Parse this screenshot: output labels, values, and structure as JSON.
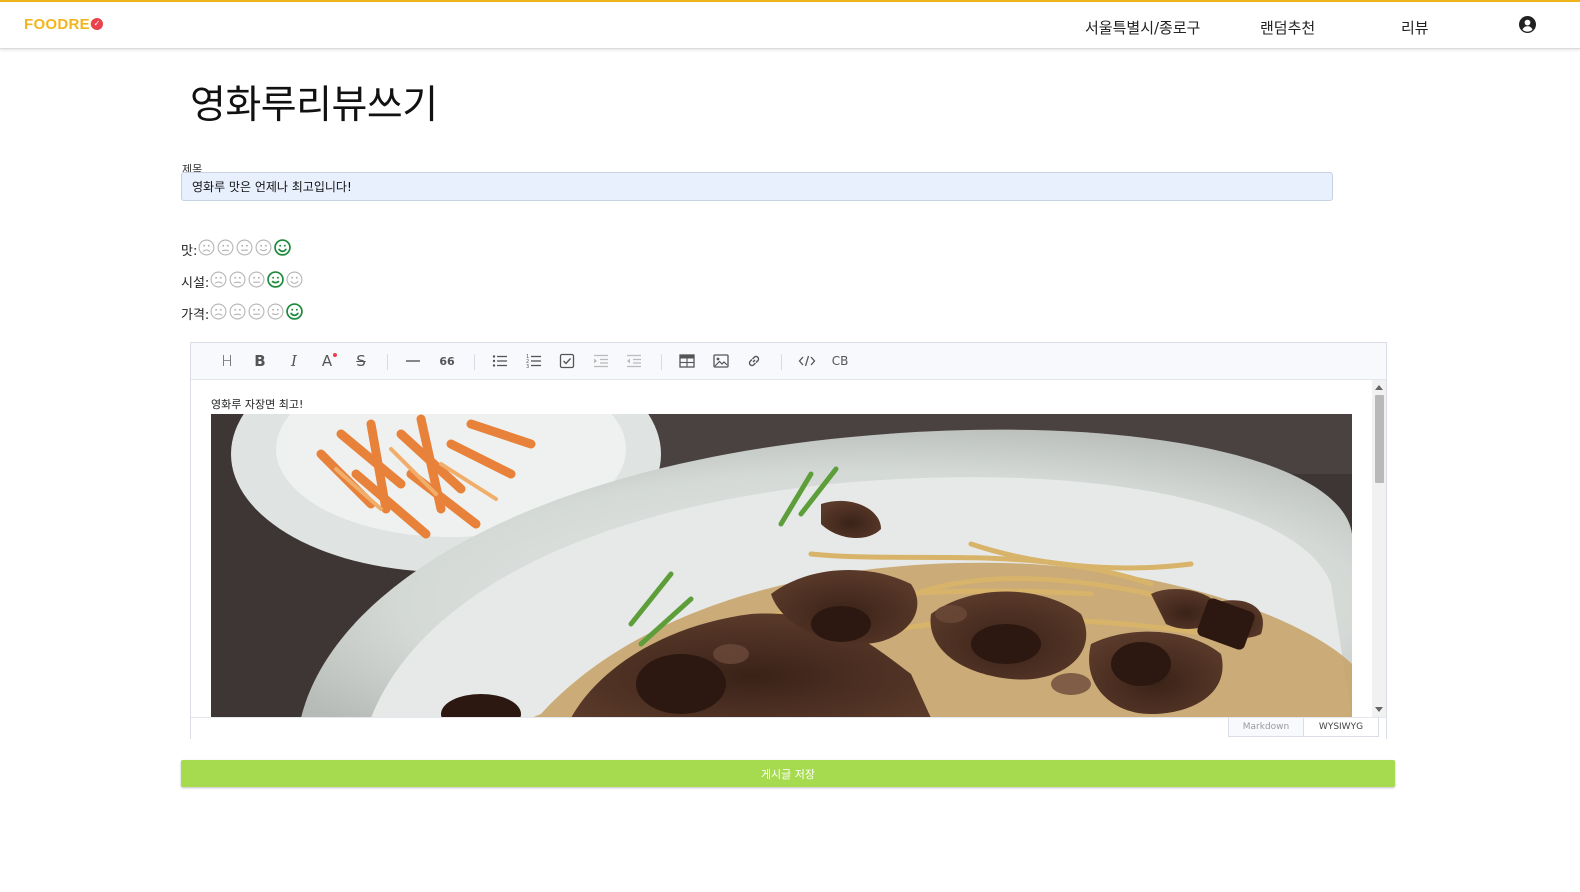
{
  "brand": {
    "logo_text": "FOODREC",
    "logo_mark": "✓",
    "accent_color": "#f2b51c"
  },
  "nav": {
    "location": "서울특별시/종로구",
    "random": "랜덤추천",
    "review": "리뷰"
  },
  "page": {
    "title": "영화루리뷰쓰기"
  },
  "form": {
    "title_label": "제목",
    "title_value": "영화루 맛은 언제나 최고입니다!",
    "ratings": [
      {
        "label": "맛:",
        "value": 5,
        "max": 5
      },
      {
        "label": "시설:",
        "value": 4,
        "max": 5
      },
      {
        "label": "가격:",
        "value": 5,
        "max": 5
      }
    ],
    "selected_color": "#1e8a3c"
  },
  "editor": {
    "toolbar": {
      "heading": "H",
      "bold": "B",
      "italic": "I",
      "color": "A",
      "strike": "S",
      "quote": "66",
      "codeblock": "CB"
    },
    "content_text": "영화루 자장면 최고!",
    "modes": {
      "markdown": "Markdown",
      "wysiwyg": "WYSIWYG"
    },
    "active_mode": "WYSIWYG"
  },
  "actions": {
    "save_label": "게시글 저장",
    "save_color": "#a6da4f"
  }
}
